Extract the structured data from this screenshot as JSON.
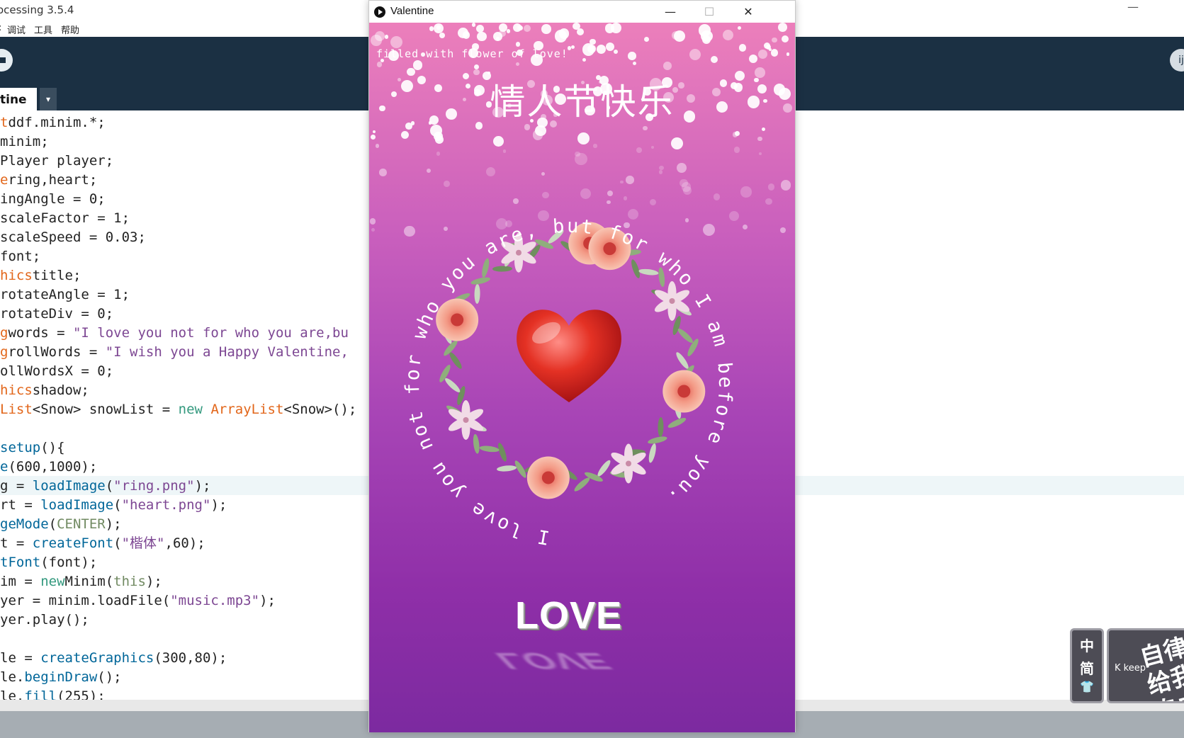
{
  "ide": {
    "title": "ocessing 3.5.4",
    "minimize": "—",
    "menu": [
      "调试",
      "工具",
      "帮助"
    ],
    "menu_left_fragment": ":",
    "tab_label": "tine",
    "tab_menu": "▾",
    "mode_fragment": "ij"
  },
  "code_lines": [
    [
      [
        "k-orange",
        "t"
      ],
      [
        "",
        "ddf.minim.*;"
      ]
    ],
    [
      [
        "",
        "minim;"
      ]
    ],
    [
      [
        "",
        "Player player;"
      ]
    ],
    [
      [
        "k-orange",
        "e"
      ],
      [
        "",
        "ring,heart;"
      ]
    ],
    [
      [
        "",
        "ingAngle = 0;"
      ]
    ],
    [
      [
        "",
        "scaleFactor = 1;"
      ]
    ],
    [
      [
        "",
        "scaleSpeed = 0.03;"
      ]
    ],
    [
      [
        "",
        "font;"
      ]
    ],
    [
      [
        "k-orange",
        "hics"
      ],
      [
        "",
        "title;"
      ]
    ],
    [
      [
        "",
        "rotateAngle = 1;"
      ]
    ],
    [
      [
        "",
        "rotateDiv = 0;"
      ]
    ],
    [
      [
        "k-orange",
        "g"
      ],
      [
        "",
        "words = "
      ],
      [
        "k-purple",
        "\"I love you not for who you are,bu"
      ]
    ],
    [
      [
        "k-orange",
        "g"
      ],
      [
        "",
        "rollWords = "
      ],
      [
        "k-purple",
        "\"I wish you a Happy Valentine,"
      ]
    ],
    [
      [
        "",
        "ollWordsX = 0;"
      ]
    ],
    [
      [
        "k-orange",
        "hics"
      ],
      [
        "",
        "shadow;"
      ]
    ],
    [
      [
        "k-orange",
        "List"
      ],
      [
        "",
        "<Snow> snowList = "
      ],
      [
        "k-green",
        "new"
      ],
      [
        "k-orange",
        " ArrayList"
      ],
      [
        "",
        "<Snow>();"
      ]
    ],
    [
      [
        "",
        "  "
      ]
    ],
    [
      [
        "k-blue",
        "setup"
      ],
      [
        "",
        "(){"
      ]
    ],
    [
      [
        "k-blue",
        "e"
      ],
      [
        "",
        "(600,1000);"
      ]
    ],
    [
      [
        "",
        "g = "
      ],
      [
        "k-blue",
        "loadImage"
      ],
      [
        "",
        "("
      ],
      [
        "k-purple",
        "\"ring.png\""
      ],
      [
        "",
        ");"
      ]
    ],
    [
      [
        "",
        "rt = "
      ],
      [
        "k-blue",
        "loadImage"
      ],
      [
        "",
        "("
      ],
      [
        "k-purple",
        "\"heart.png\""
      ],
      [
        "",
        ");"
      ]
    ],
    [
      [
        "k-blue",
        "geMode"
      ],
      [
        "",
        "("
      ],
      [
        "k-olive",
        "CENTER"
      ],
      [
        "",
        ");"
      ]
    ],
    [
      [
        "",
        "t = "
      ],
      [
        "k-blue",
        "createFont"
      ],
      [
        "",
        "("
      ],
      [
        "k-purple",
        "\"楷体\""
      ],
      [
        "",
        ",60);"
      ]
    ],
    [
      [
        "k-blue",
        "tFont"
      ],
      [
        "",
        "(font);"
      ]
    ],
    [
      [
        "",
        "im = "
      ],
      [
        "k-green",
        "new"
      ],
      [
        "",
        ""
      ],
      [
        "",
        "Minim("
      ],
      [
        "k-olive",
        "this"
      ],
      [
        "",
        ");"
      ]
    ],
    [
      [
        "",
        "yer = minim.loadFile("
      ],
      [
        "k-purple",
        "\"music.mp3\""
      ],
      [
        "",
        ");"
      ]
    ],
    [
      [
        "",
        "yer.play();"
      ]
    ],
    [
      [
        "",
        "  "
      ]
    ],
    [
      [
        "",
        "le = "
      ],
      [
        "k-blue",
        "createGraphics"
      ],
      [
        "",
        "(300,80);"
      ]
    ],
    [
      [
        "",
        "le."
      ],
      [
        "k-blue",
        "beginDraw"
      ],
      [
        "",
        "();"
      ]
    ],
    [
      [
        "",
        "le."
      ],
      [
        "k-blue",
        "fill"
      ],
      [
        "",
        "(255);"
      ]
    ]
  ],
  "valentine": {
    "window_title": "Valentine",
    "minimize": "—",
    "maximize": "☐",
    "close": "✕",
    "subtitle": "filled with flower of love!",
    "heading": "情人节快乐",
    "circle_text": "I love you not for who you are, but for who I am before you.",
    "love_word": "LOVE",
    "love_reflection": "LOVE"
  },
  "widget": {
    "lang_chars": [
      "中",
      "简",
      "👕"
    ],
    "keep_brand": "K keep",
    "keep_text": "自律给我自由"
  },
  "colors": {
    "ide_toolbar": "#1b3043",
    "canvas_top": "#ec7fbb",
    "canvas_bottom": "#7c2aa0",
    "heart": "#d42424"
  }
}
